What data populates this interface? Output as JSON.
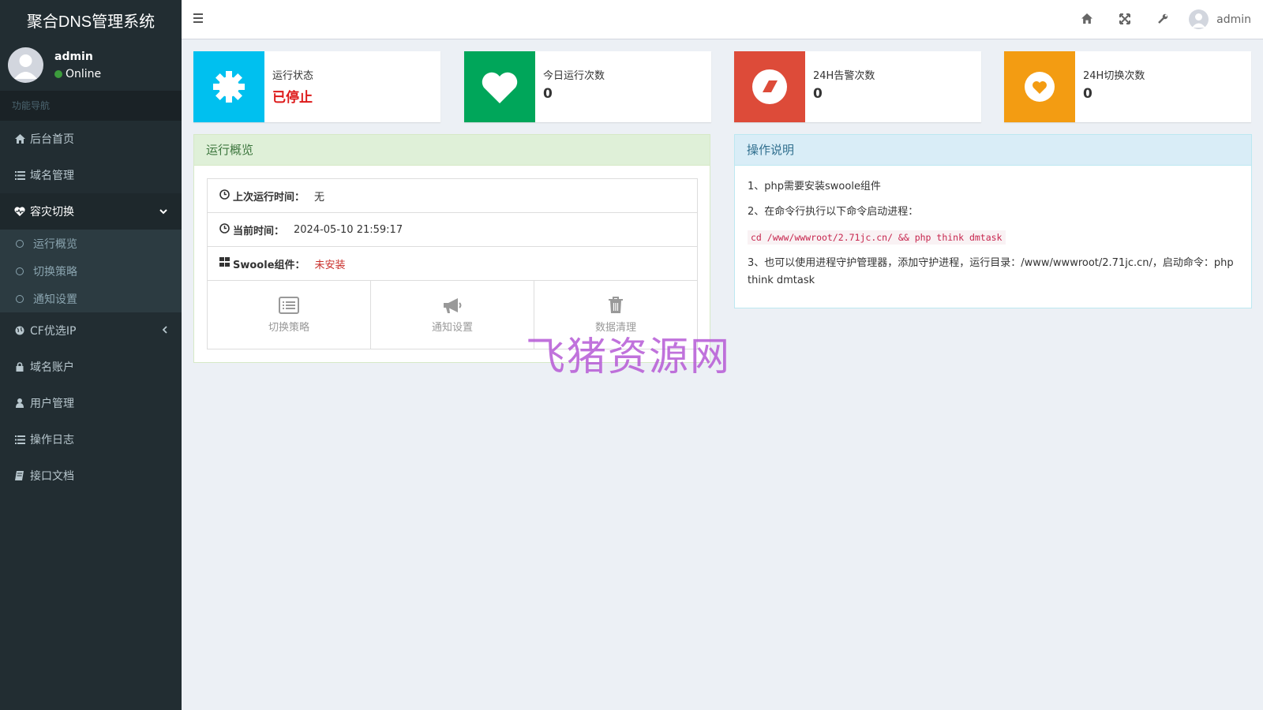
{
  "app": {
    "title": "聚合DNS管理系统"
  },
  "user": {
    "name": "admin",
    "status": "Online"
  },
  "sidebar": {
    "header": "功能导航",
    "items": [
      {
        "label": "后台首页",
        "icon": "home-icon"
      },
      {
        "label": "域名管理",
        "icon": "list-icon"
      },
      {
        "label": "容灾切换",
        "icon": "heartbeat-icon",
        "expanded": true,
        "children": [
          "运行概览",
          "切换策略",
          "通知设置"
        ]
      },
      {
        "label": "CF优选IP",
        "icon": "globe-icon"
      },
      {
        "label": "域名账户",
        "icon": "lock-icon"
      },
      {
        "label": "用户管理",
        "icon": "user-icon"
      },
      {
        "label": "操作日志",
        "icon": "list-icon"
      },
      {
        "label": "接口文档",
        "icon": "book-icon"
      }
    ]
  },
  "topbar": {
    "user_name": "admin"
  },
  "info_boxes": [
    {
      "label": "运行状态",
      "value": "已停止",
      "color": "#00c0ef",
      "icon": "cog-icon"
    },
    {
      "label": "今日运行次数",
      "value": "0",
      "color": "#00a65a",
      "icon": "heart-icon"
    },
    {
      "label": "24H告警次数",
      "value": "0",
      "color": "#dd4b39",
      "icon": "eraser-icon"
    },
    {
      "label": "24H切换次数",
      "value": "0",
      "color": "#f39c12",
      "icon": "heart-circle-icon"
    }
  ],
  "overview": {
    "title": "运行概览",
    "rows": [
      {
        "label": "上次运行时间：",
        "value": "无"
      },
      {
        "label": "当前时间：",
        "value": "2024-05-10 21:59:17"
      },
      {
        "label": "Swoole组件：",
        "value": "未安装"
      }
    ],
    "buttons": [
      "切换策略",
      "通知设置",
      "数据清理"
    ]
  },
  "instructions": {
    "title": "操作说明",
    "line1": "1、php需要安装swoole组件",
    "line2": "2、在命令行执行以下命令启动进程：",
    "code": "cd /www/wwwroot/2.71jc.cn/ && php think dmtask",
    "line3": "3、也可以使用进程守护管理器，添加守护进程，运行目录：/www/wwwroot/2.71jc.cn/，启动命令：php think dmtask"
  },
  "watermark": "飞猪资源网"
}
